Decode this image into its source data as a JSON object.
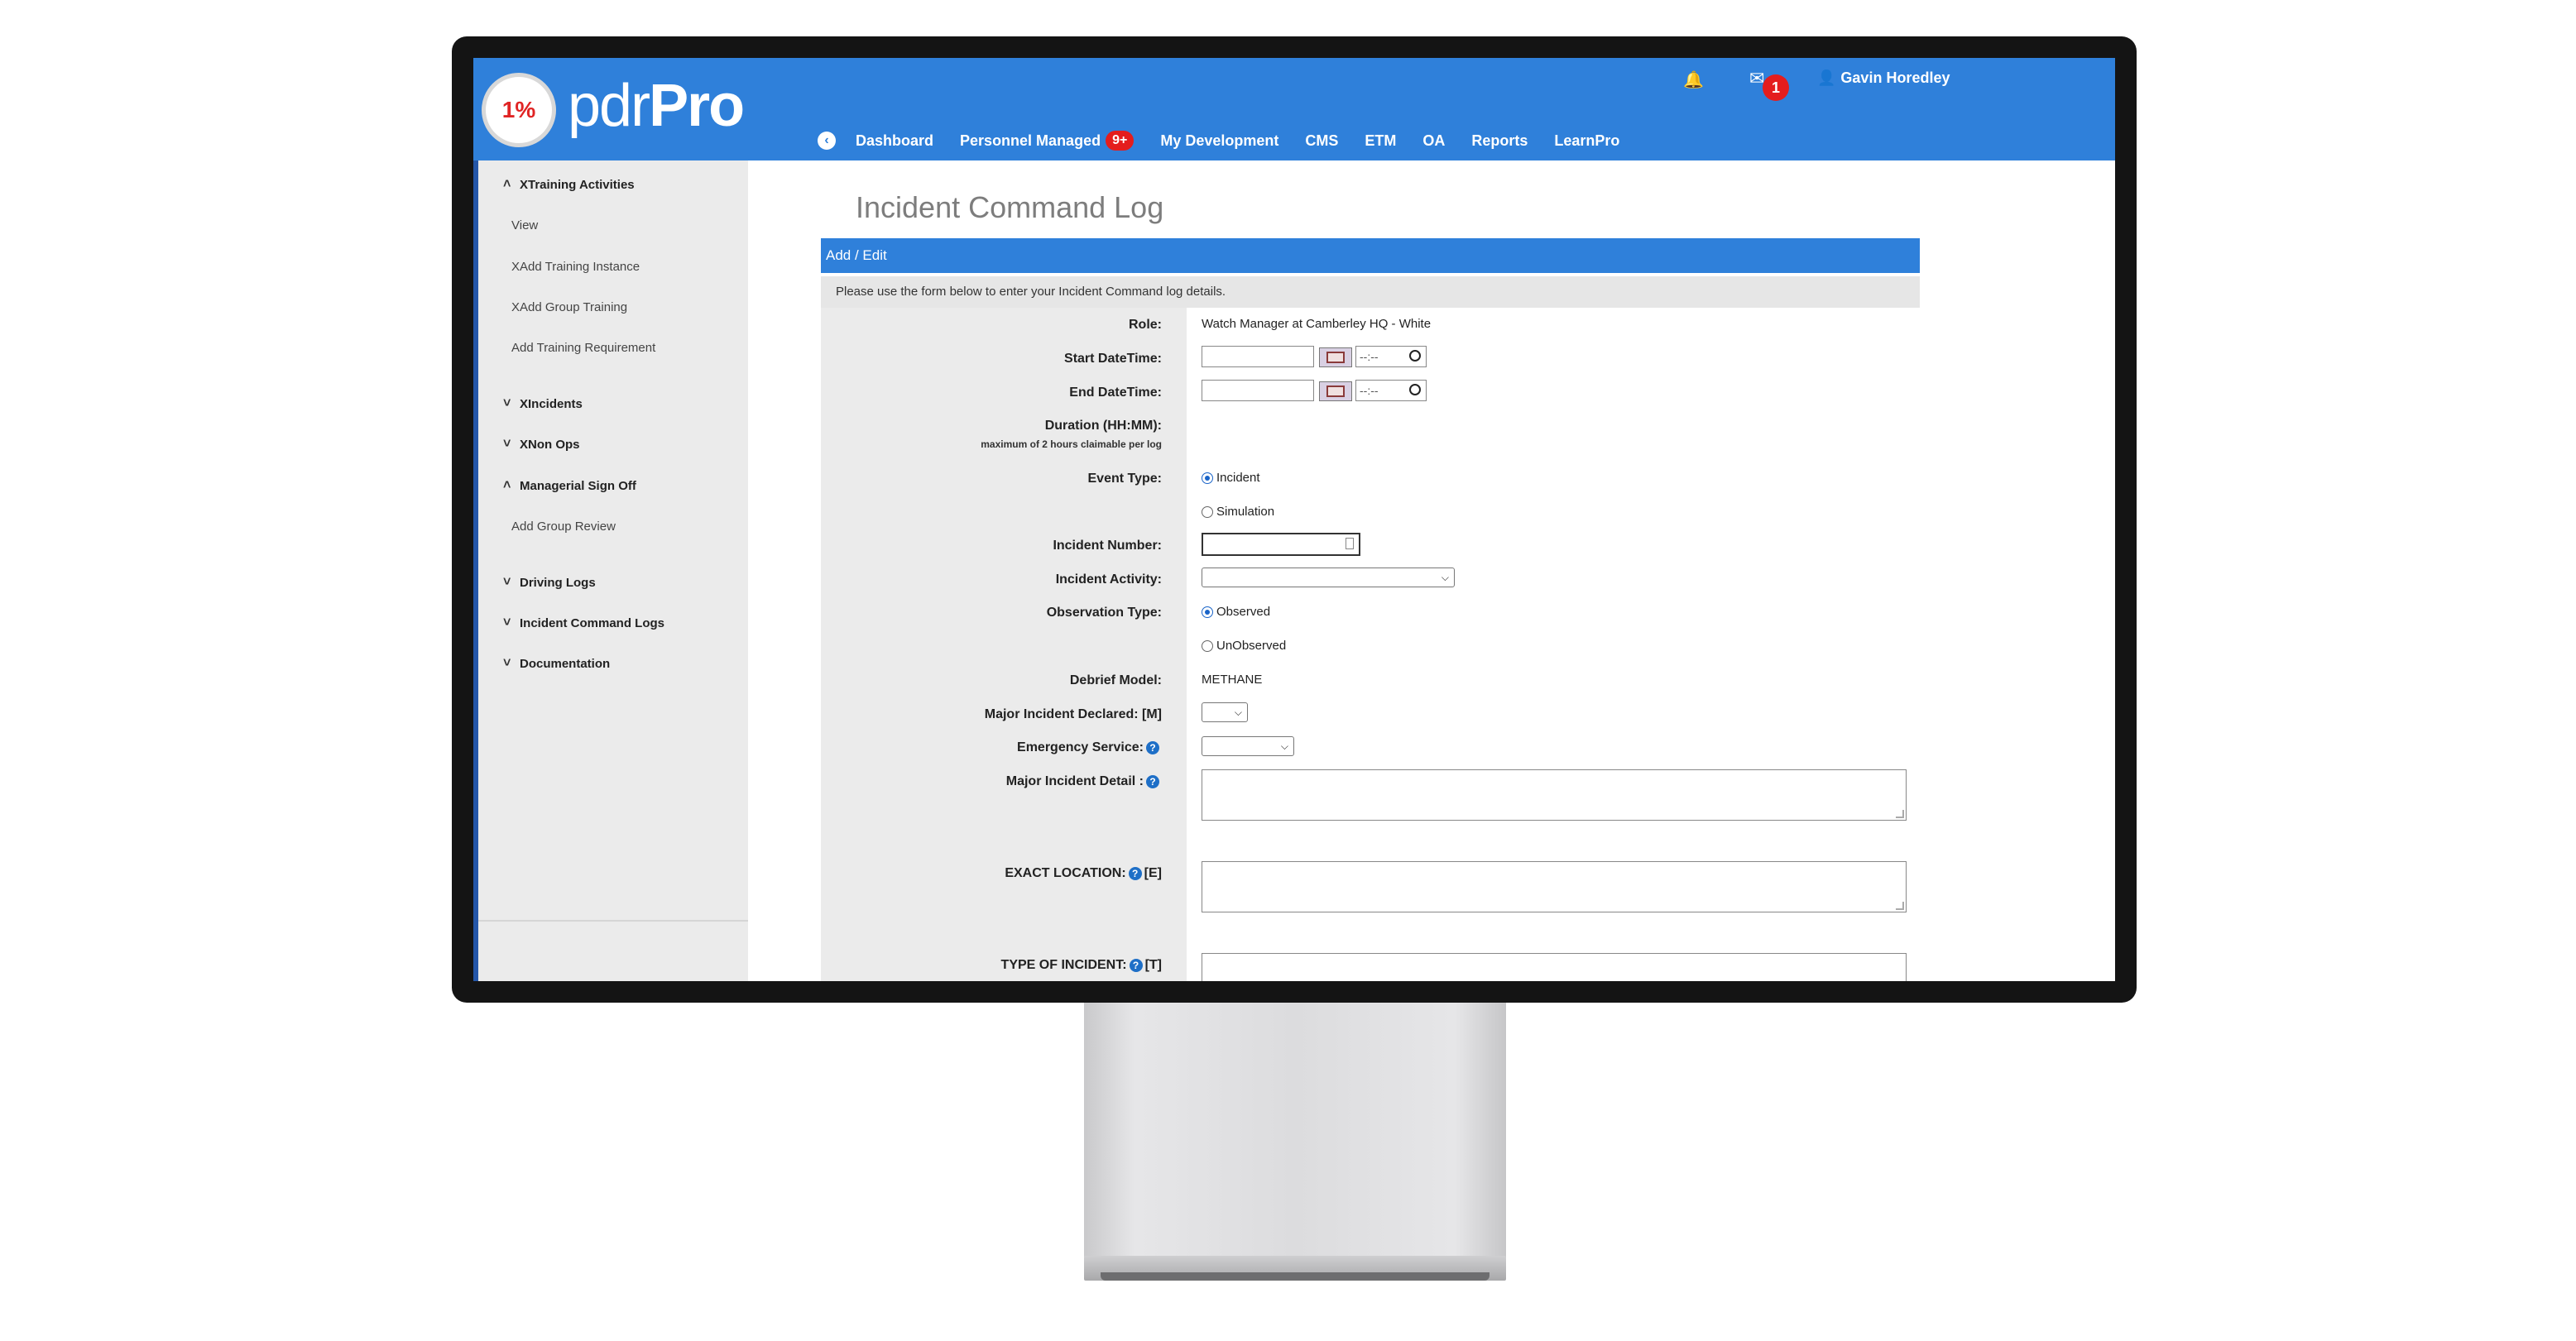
{
  "header": {
    "logo_percent": "1%",
    "brand_light": "pdr",
    "brand_bold": "Pro",
    "notifications_icon": "bell-icon",
    "mail_icon": "envelope-icon",
    "mail_count": "1",
    "user_name": "Gavin Horedley",
    "accent_color": "#2f80da"
  },
  "nav": {
    "items": [
      {
        "label": "Dashboard"
      },
      {
        "label": "Personnel Managed",
        "badge": "9+"
      },
      {
        "label": "My Development"
      },
      {
        "label": "CMS"
      },
      {
        "label": "ETM"
      },
      {
        "label": "OA"
      },
      {
        "label": "Reports"
      },
      {
        "label": "LearnPro"
      }
    ]
  },
  "sidebar": {
    "sections": [
      {
        "label": "XTraining Activities",
        "expanded": true,
        "items": [
          "View",
          "XAdd Training Instance",
          "XAdd Group Training",
          "Add Training Requirement"
        ]
      },
      {
        "label": "XIncidents",
        "expanded": false
      },
      {
        "label": "XNon Ops",
        "expanded": false
      },
      {
        "label": "Managerial Sign Off",
        "expanded": true,
        "items": [
          "Add Group Review"
        ]
      },
      {
        "label": "Driving Logs",
        "expanded": false
      },
      {
        "label": "Incident Command Logs",
        "expanded": false
      },
      {
        "label": "Documentation",
        "expanded": false
      }
    ]
  },
  "page": {
    "title": "Incident Command Log",
    "panel_title": "Add / Edit",
    "intro": "Please use the form below to enter your Incident Command log details."
  },
  "form": {
    "role_label": "Role:",
    "role_value": "Watch Manager at Camberley HQ - White",
    "start_label": "Start DateTime:",
    "end_label": "End DateTime:",
    "time_placeholder": "--:--",
    "duration_label": "Duration (HH:MM):",
    "duration_note": "maximum of 2 hours claimable per log",
    "event_type_label": "Event Type:",
    "event_type_options": [
      "Incident",
      "Simulation"
    ],
    "event_type_selected": "Incident",
    "incident_number_label": "Incident Number:",
    "incident_activity_label": "Incident Activity:",
    "observation_type_label": "Observation Type:",
    "observation_type_options": [
      "Observed",
      "UnObserved"
    ],
    "observation_type_selected": "Observed",
    "debrief_model_label": "Debrief Model:",
    "debrief_model_value": "METHANE",
    "major_incident_declared_label": "Major Incident Declared: [M]",
    "emergency_service_label": "Emergency Service:",
    "major_incident_detail_label": "Major Incident Detail :",
    "exact_location_label": "EXACT LOCATION:",
    "exact_location_code": "[E]",
    "type_of_incident_label": "TYPE OF INCIDENT:",
    "type_of_incident_code": "[T]",
    "help_glyph": "?"
  }
}
